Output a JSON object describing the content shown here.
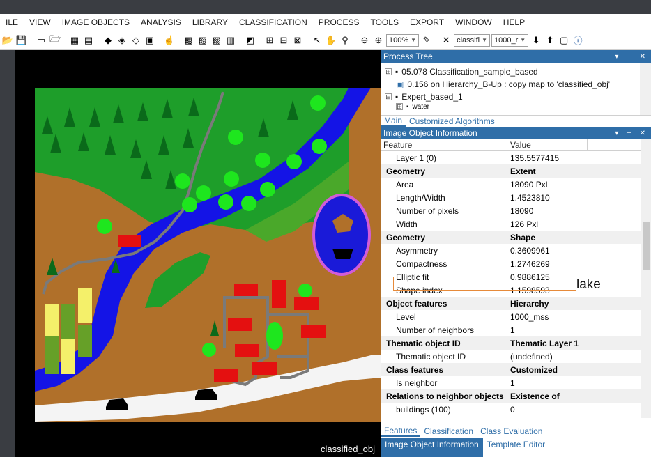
{
  "menu": [
    "ILE",
    "VIEW",
    "IMAGE OBJECTS",
    "ANALYSIS",
    "LIBRARY",
    "CLASSIFICATION",
    "PROCESS",
    "TOOLS",
    "EXPORT",
    "WINDOW",
    "HELP"
  ],
  "toolbar": {
    "zoom": "100%",
    "class_combo": "classifi",
    "level_combo": "1000_r"
  },
  "viewer": {
    "label": "classified_obj"
  },
  "process_tree": {
    "title": "Process Tree",
    "rows": [
      {
        "expander": "⊞",
        "text": "05.078   Classification_sample_based"
      },
      {
        "expander": "",
        "text": "0.156    on Hierarchy_B-Up : copy map to 'classified_obj'"
      },
      {
        "expander": "⊟",
        "text": "Expert_based_1"
      },
      {
        "expander": "⊞",
        "text": "water"
      }
    ],
    "tabs": [
      "Main",
      "Customized Algorithms"
    ]
  },
  "info": {
    "title": "Image Object Information",
    "col_feature": "Feature",
    "col_value": "Value",
    "rows": [
      {
        "type": "item",
        "f": "Layer 1 (0)",
        "v": "135.5577415"
      },
      {
        "type": "sec",
        "f": "Geometry",
        "v": "Extent"
      },
      {
        "type": "item",
        "f": "Area",
        "v": "18090 Pxl"
      },
      {
        "type": "item",
        "f": "Length/Width",
        "v": "1.4523810"
      },
      {
        "type": "item",
        "f": "Number of pixels",
        "v": "18090"
      },
      {
        "type": "item",
        "f": "Width",
        "v": "126 Pxl"
      },
      {
        "type": "sec",
        "f": "Geometry",
        "v": "Shape"
      },
      {
        "type": "item",
        "f": "Asymmetry",
        "v": "0.3609961"
      },
      {
        "type": "item",
        "f": "Compactness",
        "v": "1.2746269"
      },
      {
        "type": "item",
        "f": "Elliptic fit",
        "v": "0.9886125"
      },
      {
        "type": "item",
        "f": "Shape index",
        "v": "1.1598593"
      },
      {
        "type": "sec",
        "f": "Object features",
        "v": "Hierarchy"
      },
      {
        "type": "item",
        "f": "Level",
        "v": "1000_mss"
      },
      {
        "type": "item",
        "f": "Number of neighbors",
        "v": "1"
      },
      {
        "type": "sec",
        "f": "Thematic object ID",
        "v": "Thematic Layer 1"
      },
      {
        "type": "item",
        "f": "Thematic object ID",
        "v": "(undefined)"
      },
      {
        "type": "sec",
        "f": "Class features",
        "v": "Customized"
      },
      {
        "type": "item",
        "f": "Is neighbor",
        "v": "1"
      },
      {
        "type": "sec",
        "f": "Relations to neighbor objects",
        "v": "Existence of"
      },
      {
        "type": "item",
        "f": "buildings (100)",
        "v": "0"
      }
    ]
  },
  "bottom_tabs": [
    "Features",
    "Classification",
    "Class Evaluation"
  ],
  "bottom_panel_tabs": [
    "Image Object Information",
    "Template Editor"
  ],
  "annotation": "lake",
  "colors": {
    "accent": "#2f6ea8",
    "highlight": "#e68a3a"
  }
}
